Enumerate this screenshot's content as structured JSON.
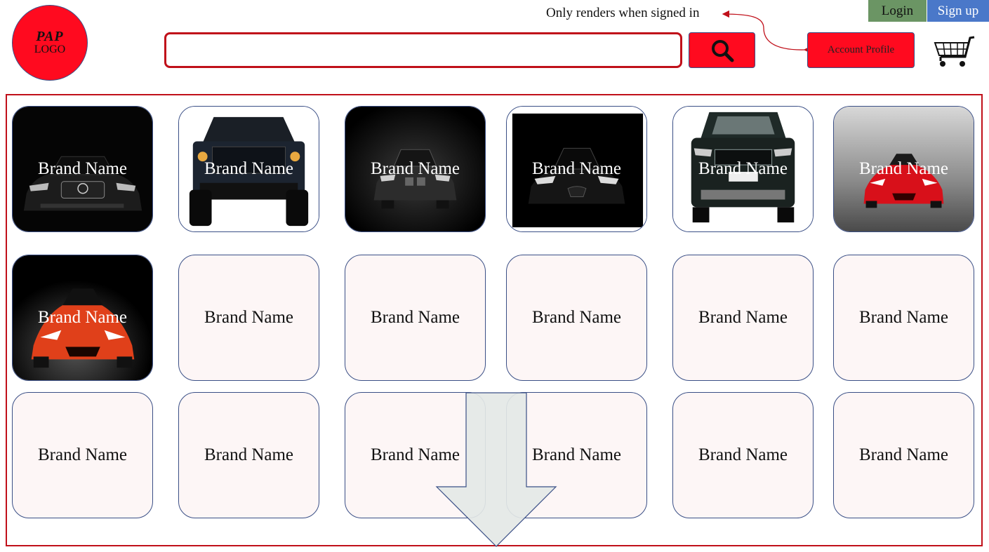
{
  "header": {
    "logo_mark": "PAP",
    "logo_text": "LOGO",
    "search": {
      "value": "",
      "placeholder": ""
    },
    "search_icon": "search-icon",
    "signed_in_note": "Only renders when signed in",
    "login_label": "Login",
    "signup_label": "Sign up",
    "account_label": "Account Profile",
    "cart_icon": "shopping-cart-icon"
  },
  "colors": {
    "brand_red": "#ff0a1f",
    "border_red": "#c0101a",
    "login_green": "#6b9564",
    "signup_blue": "#4a78c9",
    "card_border": "#3a4f86",
    "card_fill": "#fdf6f6"
  },
  "grid": {
    "cards": [
      {
        "label": "Brand Name",
        "image": "black-mercedes-front"
      },
      {
        "label": "Brand Name",
        "image": "black-pickup-truck-front"
      },
      {
        "label": "Brand Name",
        "image": "dark-bmw-suv-front"
      },
      {
        "label": "Brand Name",
        "image": "black-tesla-front"
      },
      {
        "label": "Brand Name",
        "image": "dark-range-rover-front"
      },
      {
        "label": "Brand Name",
        "image": "red-ferrari-front"
      },
      {
        "label": "Brand Name",
        "image": "orange-lamborghini-front"
      },
      {
        "label": "Brand Name",
        "image": ""
      },
      {
        "label": "Brand Name",
        "image": ""
      },
      {
        "label": "Brand Name",
        "image": ""
      },
      {
        "label": "Brand Name",
        "image": ""
      },
      {
        "label": "Brand Name",
        "image": ""
      },
      {
        "label": "Brand Name",
        "image": ""
      },
      {
        "label": "Brand Name",
        "image": ""
      },
      {
        "label": "Brand Name",
        "image": ""
      },
      {
        "label": "Brand Name",
        "image": ""
      },
      {
        "label": "Brand Name",
        "image": ""
      },
      {
        "label": "Brand Name",
        "image": ""
      }
    ]
  },
  "scroll_indicator": "scroll-down-arrow-icon"
}
